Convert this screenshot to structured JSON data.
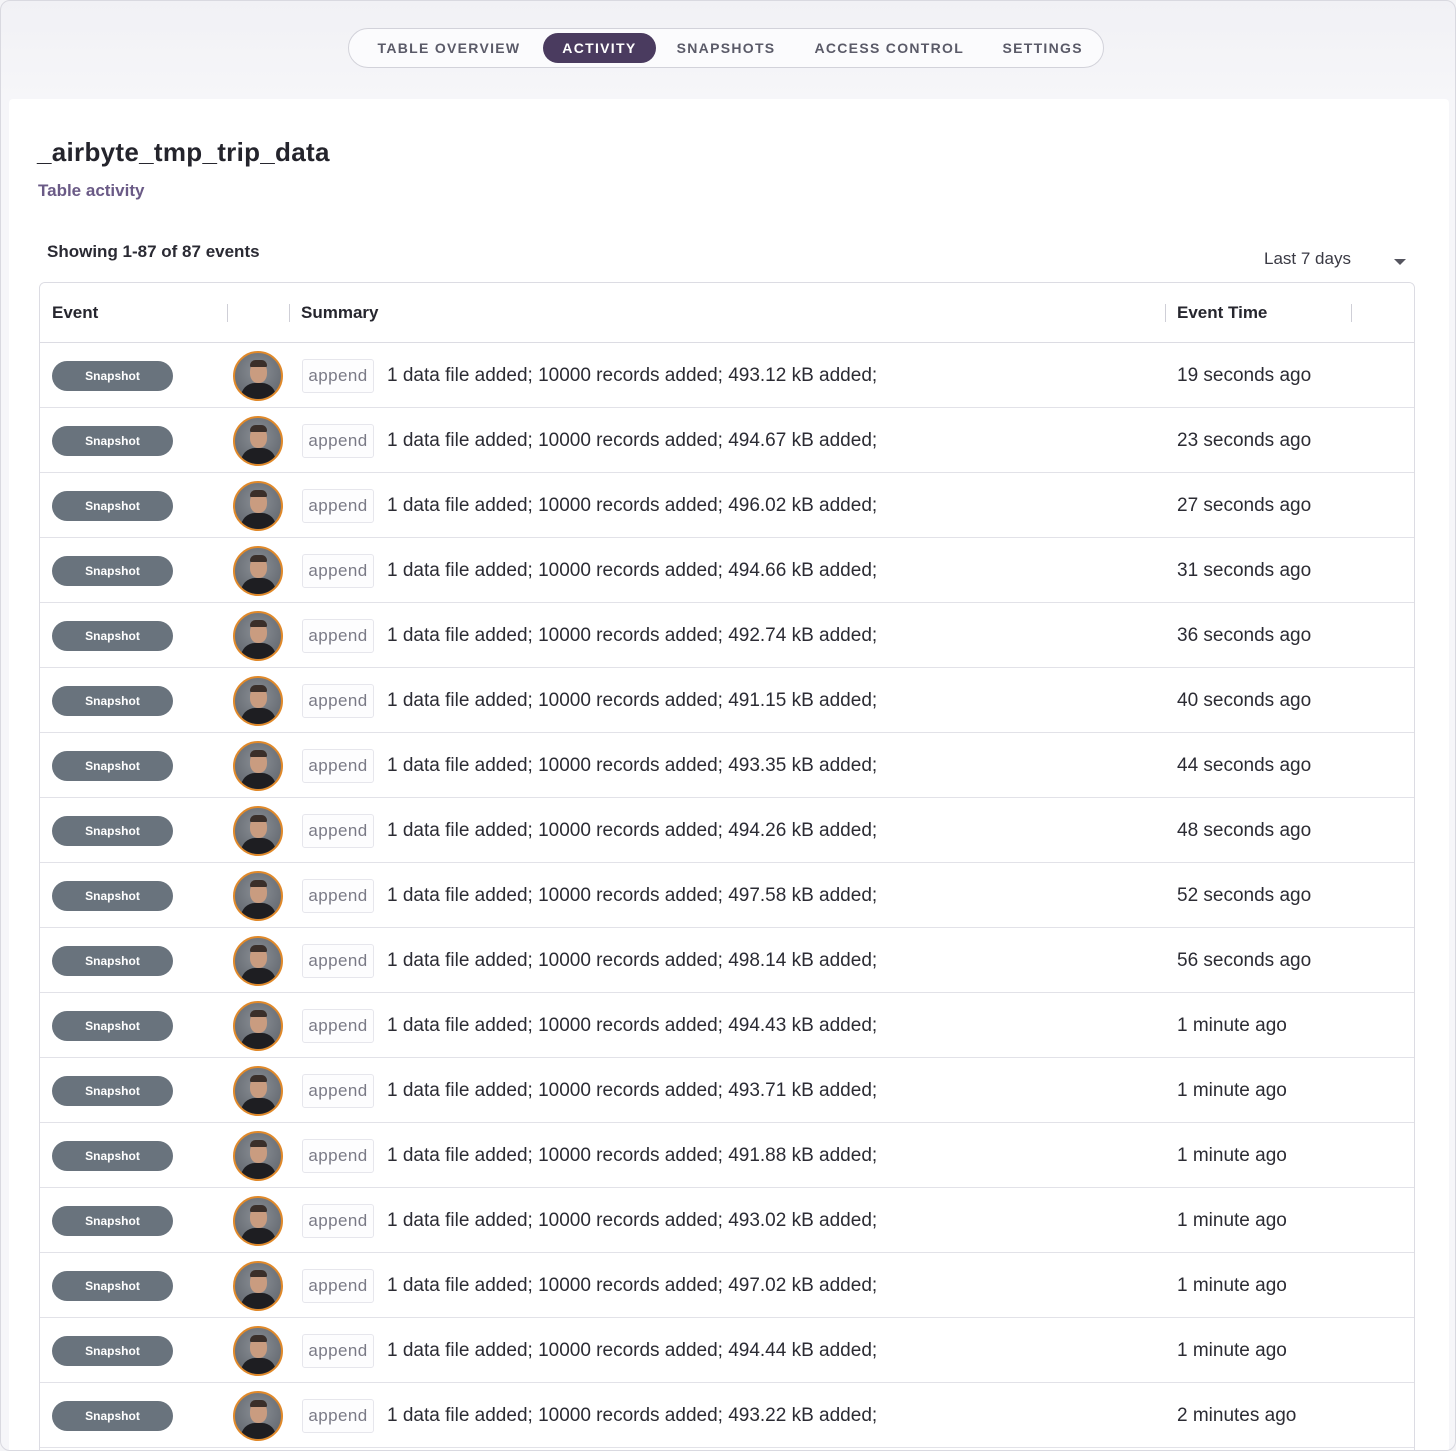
{
  "tabs": [
    {
      "label": "TABLE OVERVIEW",
      "active": false
    },
    {
      "label": "ACTIVITY",
      "active": true
    },
    {
      "label": "SNAPSHOTS",
      "active": false
    },
    {
      "label": "ACCESS CONTROL",
      "active": false
    },
    {
      "label": "SETTINGS",
      "active": false
    }
  ],
  "page": {
    "title": "_airbyte_tmp_trip_data",
    "subtitle": "Table activity",
    "showing": "Showing 1-87 of 87 events",
    "range_label": "Last 7 days"
  },
  "table": {
    "headers": {
      "event": "Event",
      "summary": "Summary",
      "event_time": "Event Time"
    },
    "rows": [
      {
        "event": "Snapshot",
        "operation": "append",
        "summary": "1 data file added; 10000 records added; 493.12 kB added;",
        "time": "19 seconds ago"
      },
      {
        "event": "Snapshot",
        "operation": "append",
        "summary": "1 data file added; 10000 records added; 494.67 kB added;",
        "time": "23 seconds ago"
      },
      {
        "event": "Snapshot",
        "operation": "append",
        "summary": "1 data file added; 10000 records added; 496.02 kB added;",
        "time": "27 seconds ago"
      },
      {
        "event": "Snapshot",
        "operation": "append",
        "summary": "1 data file added; 10000 records added; 494.66 kB added;",
        "time": "31 seconds ago"
      },
      {
        "event": "Snapshot",
        "operation": "append",
        "summary": "1 data file added; 10000 records added; 492.74 kB added;",
        "time": "36 seconds ago"
      },
      {
        "event": "Snapshot",
        "operation": "append",
        "summary": "1 data file added; 10000 records added; 491.15 kB added;",
        "time": "40 seconds ago"
      },
      {
        "event": "Snapshot",
        "operation": "append",
        "summary": "1 data file added; 10000 records added; 493.35 kB added;",
        "time": "44 seconds ago"
      },
      {
        "event": "Snapshot",
        "operation": "append",
        "summary": "1 data file added; 10000 records added; 494.26 kB added;",
        "time": "48 seconds ago"
      },
      {
        "event": "Snapshot",
        "operation": "append",
        "summary": "1 data file added; 10000 records added; 497.58 kB added;",
        "time": "52 seconds ago"
      },
      {
        "event": "Snapshot",
        "operation": "append",
        "summary": "1 data file added; 10000 records added; 498.14 kB added;",
        "time": "56 seconds ago"
      },
      {
        "event": "Snapshot",
        "operation": "append",
        "summary": "1 data file added; 10000 records added; 494.43 kB added;",
        "time": "1 minute ago"
      },
      {
        "event": "Snapshot",
        "operation": "append",
        "summary": "1 data file added; 10000 records added; 493.71 kB added;",
        "time": "1 minute ago"
      },
      {
        "event": "Snapshot",
        "operation": "append",
        "summary": "1 data file added; 10000 records added; 491.88 kB added;",
        "time": "1 minute ago"
      },
      {
        "event": "Snapshot",
        "operation": "append",
        "summary": "1 data file added; 10000 records added; 493.02 kB added;",
        "time": "1 minute ago"
      },
      {
        "event": "Snapshot",
        "operation": "append",
        "summary": "1 data file added; 10000 records added; 497.02 kB added;",
        "time": "1 minute ago"
      },
      {
        "event": "Snapshot",
        "operation": "append",
        "summary": "1 data file added; 10000 records added; 494.44 kB added;",
        "time": "1 minute ago"
      },
      {
        "event": "Snapshot",
        "operation": "append",
        "summary": "1 data file added; 10000 records added; 493.22 kB added;",
        "time": "2 minutes ago"
      }
    ]
  },
  "colors": {
    "active_tab": "#4a3b5f",
    "event_pill": "#69737d",
    "avatar_ring": "#e0892a",
    "subtitle": "#6a5a86"
  }
}
